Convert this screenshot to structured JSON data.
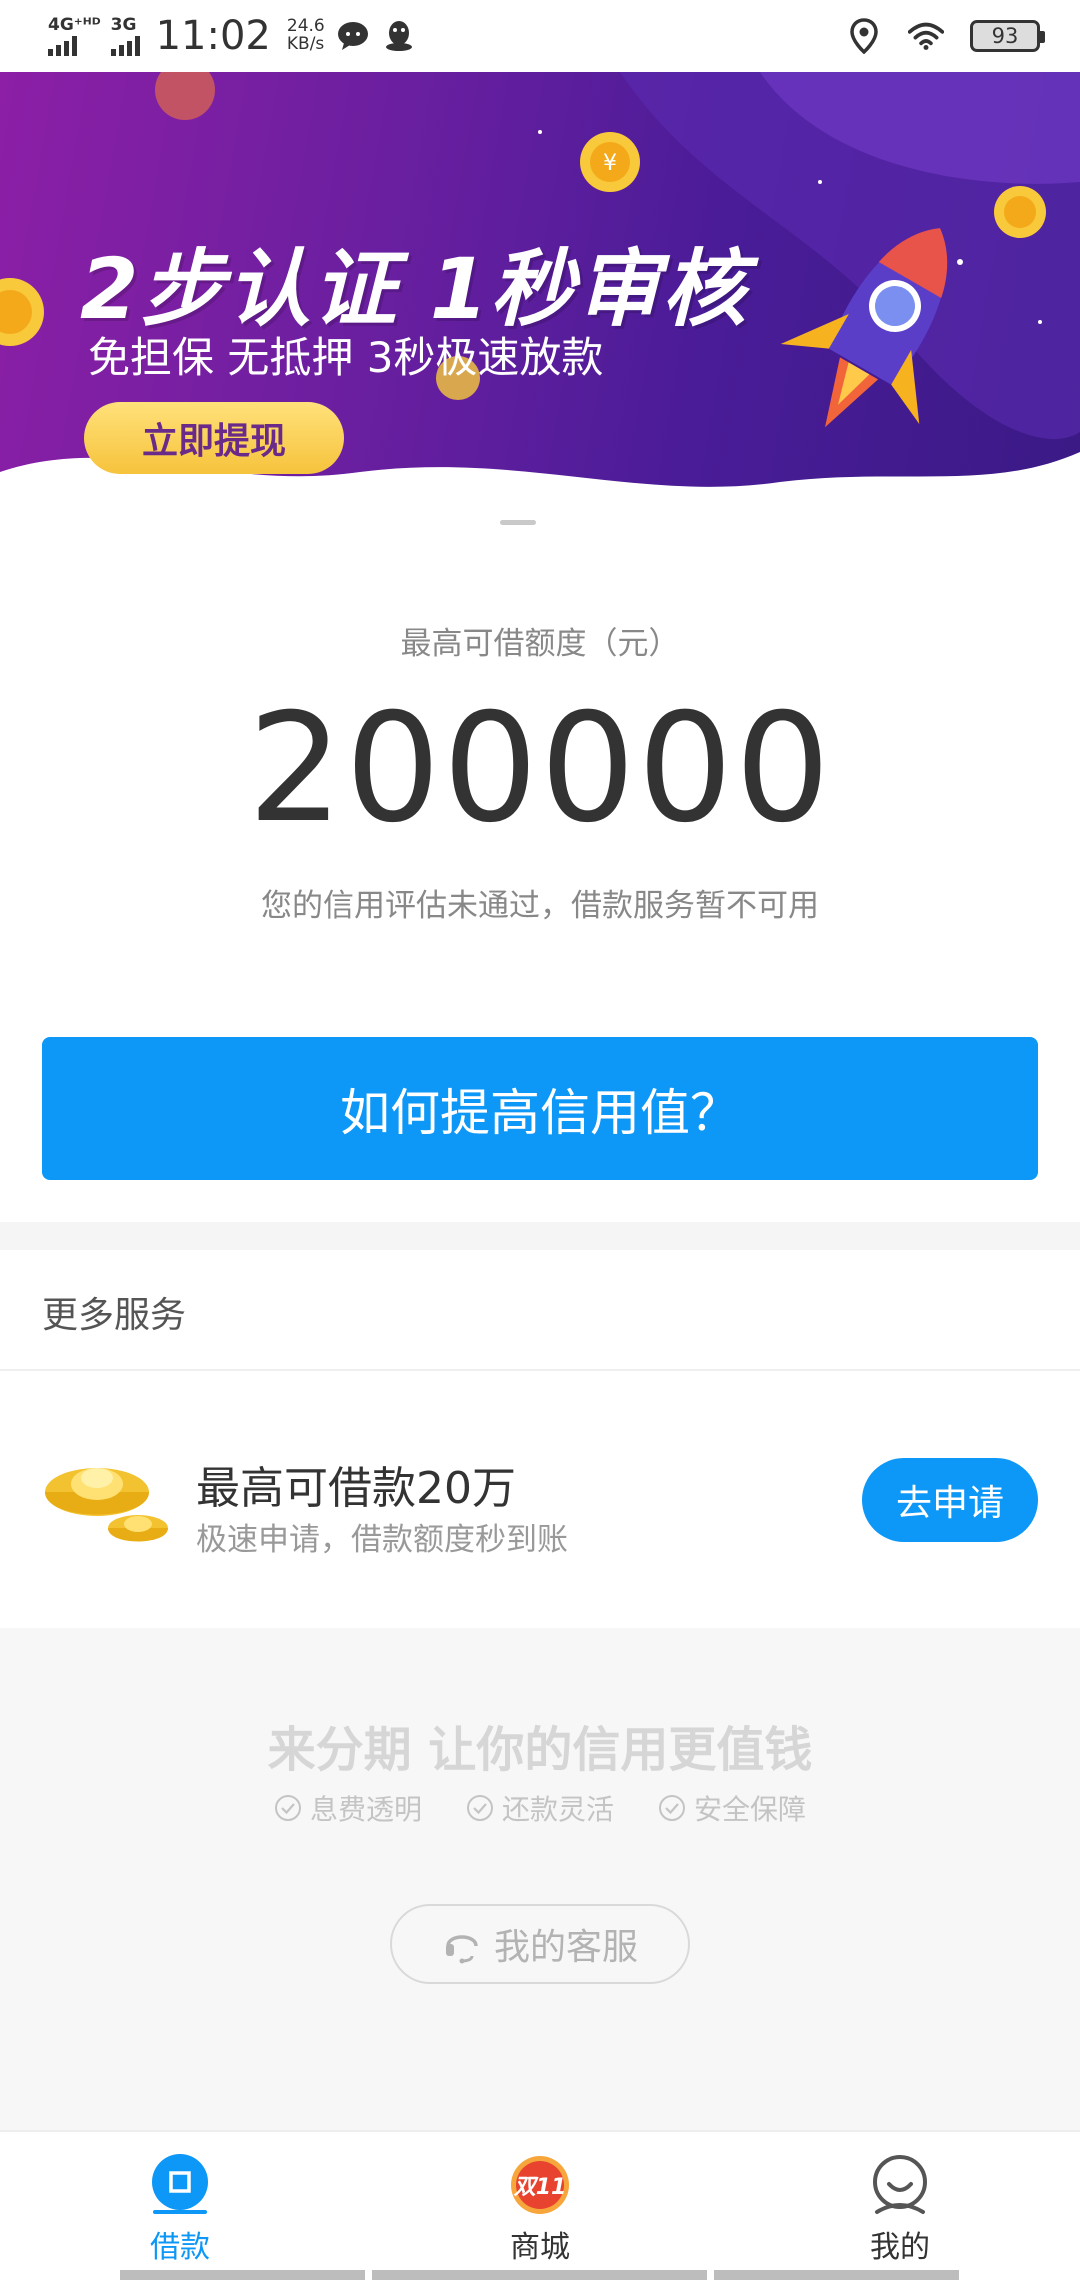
{
  "status_bar": {
    "network_1": "4G⁺ᴴᴰ",
    "network_2": "3G",
    "time": "11:02",
    "speed_value": "24.6",
    "speed_unit": "KB/s",
    "battery": "93"
  },
  "banner": {
    "title": "2步认证 1秒审核",
    "subtitle": "免担保 无抵押 3秒极速放款",
    "button_label": "立即提现"
  },
  "credit": {
    "label": "最高可借额度（元）",
    "amount": "200000",
    "note": "您的信用评估未通过，借款服务暂不可用",
    "button_label": "如何提高信用值？"
  },
  "more_services": {
    "title": "更多服务",
    "item": {
      "title": "最高可借款20万",
      "desc": "极速申请，借款额度秒到账",
      "button_label": "去申请"
    }
  },
  "footer": {
    "slogan": "来分期 让你的信用更值钱",
    "features": [
      "息费透明",
      "还款灵活",
      "安全保障"
    ],
    "service_button": "我的客服"
  },
  "tabs": [
    {
      "label": "借款",
      "icon": "loan-icon",
      "active": true
    },
    {
      "label": "商城",
      "icon": "double11-icon",
      "badge": "双11",
      "active": false
    },
    {
      "label": "我的",
      "icon": "profile-icon",
      "active": false
    }
  ],
  "colors": {
    "accent": "#0d97f6",
    "banner_purple": "#6a1fa0",
    "banner_button": "#f6c33c"
  }
}
